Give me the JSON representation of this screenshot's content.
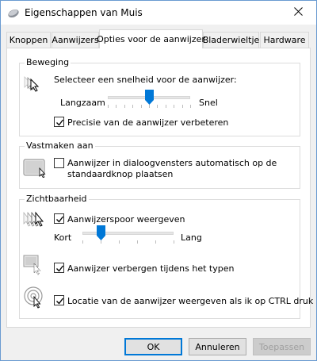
{
  "window": {
    "title": "Eigenschappen van Muis",
    "icon": "mouse-icon",
    "close_icon": "close-icon"
  },
  "tabs": [
    {
      "label": "Knoppen",
      "active": false
    },
    {
      "label": "Aanwijzers",
      "active": false
    },
    {
      "label": "Opties voor de aanwijzer",
      "active": true
    },
    {
      "label": "Bladerwieltje",
      "active": false
    },
    {
      "label": "Hardware",
      "active": false
    }
  ],
  "motion": {
    "title": "Beweging",
    "speed_label": "Selecteer een snelheid voor de aanwijzer:",
    "slow_label": "Langzaam",
    "fast_label": "Snel",
    "speed_value": 0.5,
    "precision": {
      "label": "Precisie van de aanwijzer verbeteren",
      "checked": true
    }
  },
  "snap": {
    "title": "Vastmaken aan",
    "snap_checkbox": {
      "label_line1": "Aanwijzer in dialoogvensters automatisch op de",
      "label_line2": "standaardknop plaatsen",
      "checked": false
    }
  },
  "visibility": {
    "title": "Zichtbaarheid",
    "trails": {
      "label": "Aanwijzerspoor weergeven",
      "checked": true
    },
    "short_label": "Kort",
    "long_label": "Lang",
    "trail_length_value": 0.2,
    "hide_typing": {
      "label": "Aanwijzer verbergen tijdens het typen",
      "checked": true
    },
    "ctrl_locate": {
      "label": "Locatie van de aanwijzer weergeven als ik op CTRL druk",
      "checked": true
    }
  },
  "buttons": {
    "ok": "OK",
    "cancel": "Annuleren",
    "apply": "Toepassen",
    "apply_enabled": false
  },
  "colors": {
    "accent": "#0078d7",
    "window_border": "#6a9bd1"
  }
}
